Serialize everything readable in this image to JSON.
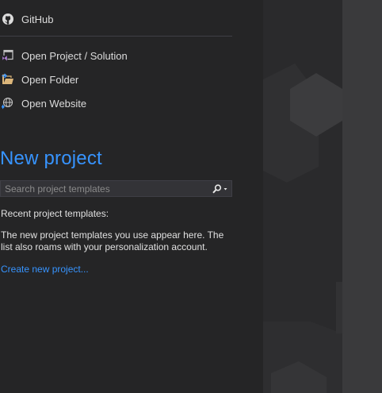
{
  "links": {
    "github": "GitHub",
    "open_project": "Open Project / Solution",
    "open_folder": "Open Folder",
    "open_website": "Open Website"
  },
  "new_project": {
    "title": "New project",
    "search_placeholder": "Search project templates",
    "recent_label": "Recent project templates:",
    "info_line1": "The new project templates you use appear here. The",
    "info_line2": "list also roams with your personalization account.",
    "create_link": "Create new project..."
  },
  "colors": {
    "accent": "#3794ff",
    "background": "#252526",
    "text": "#dcdcdc"
  },
  "icons": [
    "github-icon",
    "open-project-icon",
    "open-folder-icon",
    "open-website-icon",
    "search-icon",
    "dropdown-arrow-icon"
  ]
}
